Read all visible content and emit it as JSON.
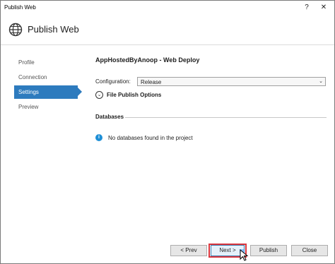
{
  "window": {
    "title": "Publish Web",
    "help_glyph": "?",
    "close_glyph": "✕"
  },
  "header": {
    "title": "Publish Web"
  },
  "nav": {
    "items": [
      {
        "label": "Profile",
        "active": false
      },
      {
        "label": "Connection",
        "active": false
      },
      {
        "label": "Settings",
        "active": true
      },
      {
        "label": "Preview",
        "active": false
      }
    ]
  },
  "settings": {
    "profile_title": "AppHostedByAnoop - Web Deploy",
    "configuration_label": "Configuration:",
    "configuration_value": "Release",
    "select_arrow": "⌄",
    "file_publish_options": "File Publish Options",
    "expander_glyph": "⌄",
    "databases_label": "Databases",
    "info_glyph": "i",
    "no_databases": "No databases found in the project"
  },
  "footer": {
    "prev": "< Prev",
    "next": "Next >",
    "publish": "Publish",
    "close": "Close"
  },
  "colors": {
    "accent": "#2d7bbe",
    "highlight_border": "#d9363e",
    "info": "#1e8fd6"
  }
}
